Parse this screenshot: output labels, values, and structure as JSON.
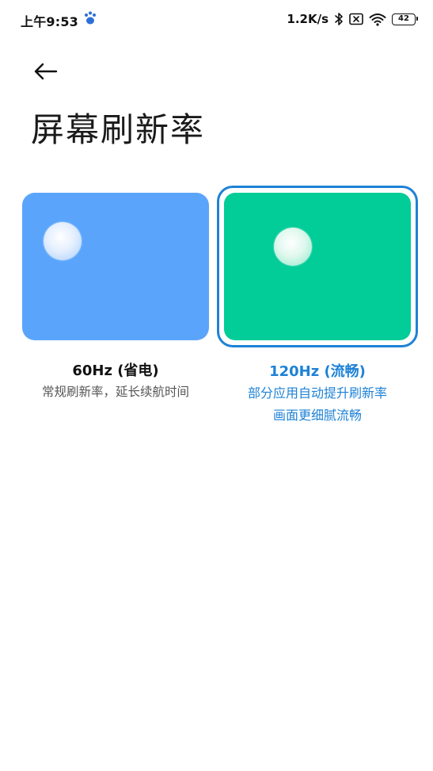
{
  "status_bar": {
    "time": "上午9:53",
    "net_speed": "1.2K/s",
    "battery": "42"
  },
  "header": {
    "title": "屏幕刷新率"
  },
  "options": [
    {
      "name": "60Hz (省电)",
      "desc_lines": [
        "常规刷新率，延长续航时间"
      ],
      "selected": false,
      "color": "#5aa5fb"
    },
    {
      "name": "120Hz (流畅)",
      "desc_lines": [
        "部分应用自动提升刷新率",
        "画面更细腻流畅"
      ],
      "selected": true,
      "color": "#02cc98"
    }
  ],
  "colors": {
    "accent": "#1e82d6"
  }
}
